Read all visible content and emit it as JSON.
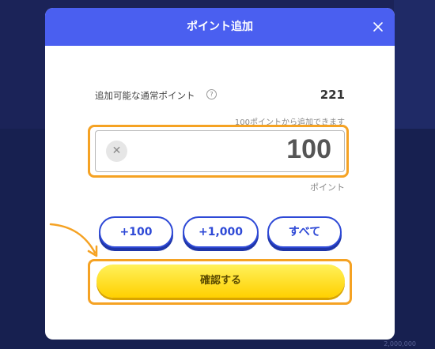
{
  "modal": {
    "title": "ポイント追加",
    "points_label": "追加可能な通常ポイント",
    "points_value": "221",
    "points_note": "100ポイントから追加できます",
    "amount_value": "100",
    "unit_label": "ポイント",
    "chips": [
      {
        "label": "+100"
      },
      {
        "label": "+1,000"
      },
      {
        "label": "すべて"
      }
    ],
    "confirm_label": "確認する"
  },
  "background": {
    "corner_number": "2,000,000"
  },
  "colors": {
    "header": "#4a5ff0",
    "highlight": "#f5a223",
    "chip_border": "#2e49d6",
    "confirm": "#ffd000",
    "backdrop": "#1b2358"
  },
  "icons": {
    "close": "close-icon",
    "help": "help-icon",
    "clear": "clear-icon",
    "arrow": "arrow-icon"
  }
}
